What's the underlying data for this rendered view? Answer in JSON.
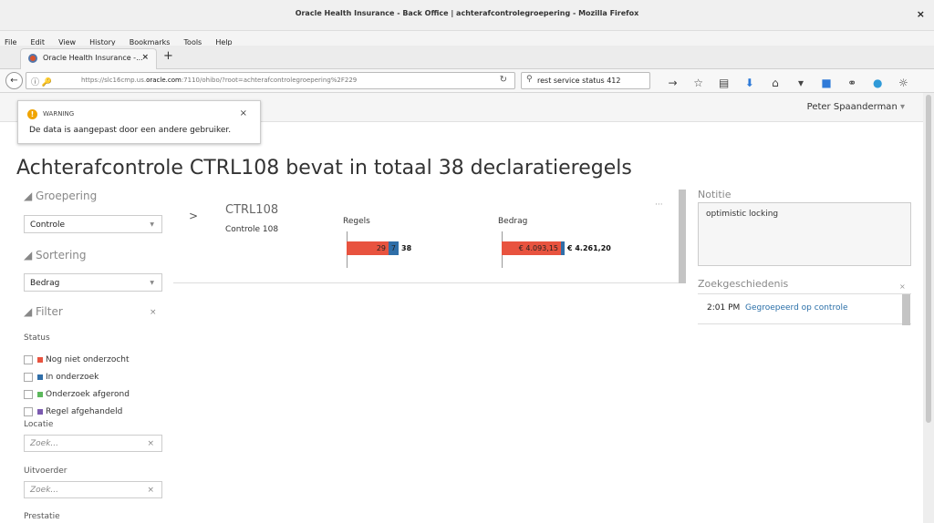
{
  "window": {
    "title": "Oracle Health Insurance - Back Office | achterafcontrolegroepering - Mozilla Firefox",
    "close": "×"
  },
  "menu": [
    "File",
    "Edit",
    "View",
    "History",
    "Bookmarks",
    "Tools",
    "Help"
  ],
  "tab": {
    "label": "Oracle Health Insurance -...",
    "close": "×",
    "new": "+"
  },
  "nav": {
    "url_prefix": "https://slc16cmp.us.",
    "url_domain": "oracle.com",
    "url_suffix": ":7110/ohibo/?root=achterafcontrolegroepering%2F229",
    "search_query": "rest service status 412"
  },
  "user": {
    "name": "Peter Spaanderman",
    "caret": "▾"
  },
  "toast": {
    "title": "WARNING",
    "message": "De data is aangepast door een andere gebruiker.",
    "close": "×"
  },
  "heading": "Achterafcontrole CTRL108 bevat in totaal 38 declaratieregels",
  "sidebar": {
    "grouping": {
      "title": "◢ Groepering",
      "value": "Controle"
    },
    "sorting": {
      "title": "◢ Sortering",
      "value": "Bedrag"
    },
    "filter": {
      "title": "◢ Filter",
      "close": "×",
      "status_label": "Status",
      "statuses": [
        {
          "label": "Nog niet onderzocht",
          "color": "#e8533f"
        },
        {
          "label": "In onderzoek",
          "color": "#2f6ea8"
        },
        {
          "label": "Onderzoek afgerond",
          "color": "#5cb85c"
        },
        {
          "label": "Regel afgehandeld",
          "color": "#7b5ab0"
        }
      ],
      "locatie_label": "Locatie",
      "locatie_placeholder": "Zoek...",
      "uitvoerder_label": "Uitvoerder",
      "uitvoerder_placeholder": "Zoek...",
      "prestatie_label": "Prestatie"
    }
  },
  "card": {
    "expander": ">",
    "code": "CTRL108",
    "description": "Controle 108",
    "more": "···",
    "regels": {
      "title": "Regels",
      "segments": [
        {
          "value": 29,
          "label": "29",
          "color": "#e8533f"
        },
        {
          "value": 7,
          "label": "7",
          "color": "#2f6ea8"
        }
      ],
      "total": "38"
    },
    "bedrag": {
      "title": "Bedrag",
      "segments": [
        {
          "value": 4093.15,
          "label": "€ 4.093,15",
          "color": "#e8533f"
        },
        {
          "value": 168.05,
          "label": "",
          "color": "#2f6ea8"
        }
      ],
      "total": "€ 4.261,20"
    }
  },
  "notes": {
    "title": "Notitie",
    "text": "optimistic locking"
  },
  "history": {
    "title": "Zoekgeschiedenis",
    "close": "×",
    "time": "2:01 PM",
    "link": "Gegroepeerd op controle"
  }
}
